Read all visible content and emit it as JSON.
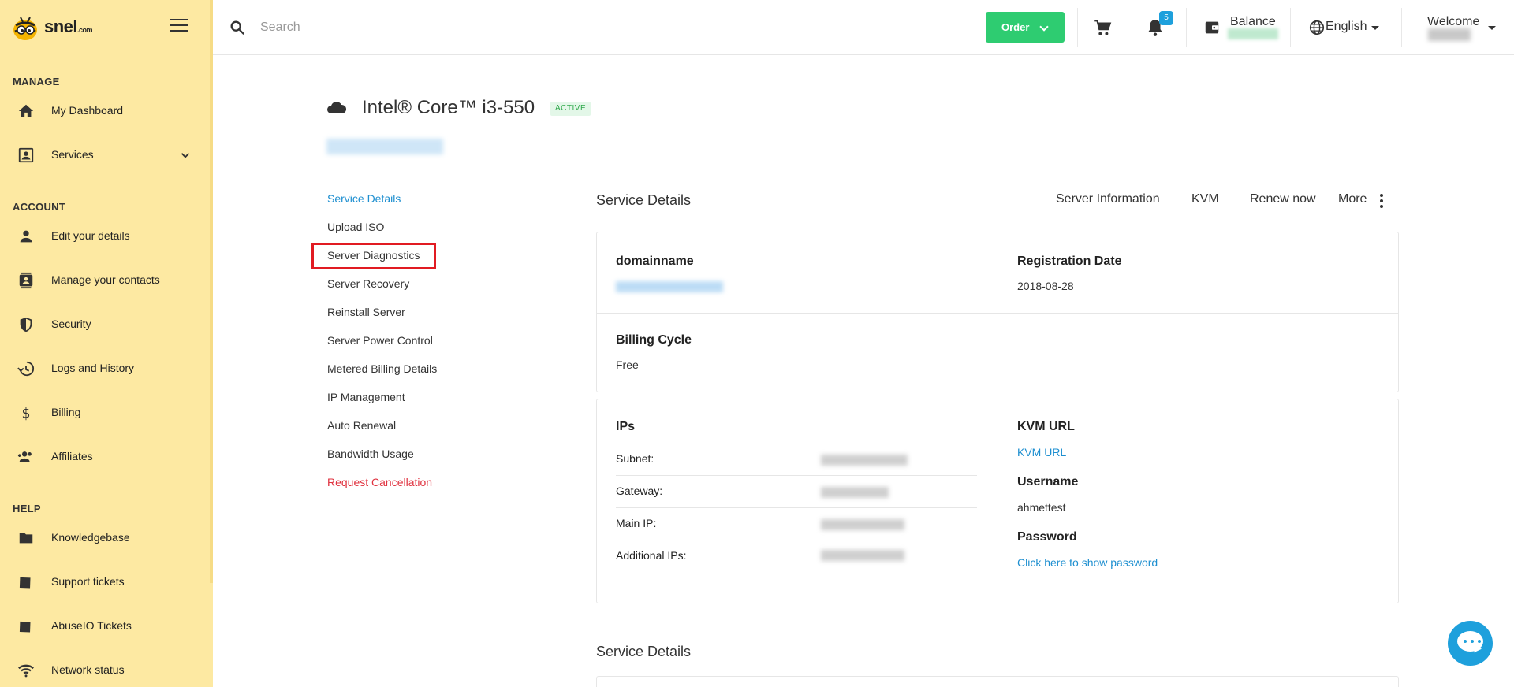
{
  "brand": {
    "name": "snel",
    "suffix": ".com"
  },
  "search": {
    "placeholder": "Search"
  },
  "header": {
    "order_label": "Order",
    "notifications_count": "5",
    "balance_label": "Balance",
    "language": "English",
    "welcome_label": "Welcome"
  },
  "sidebar": {
    "sections": [
      {
        "label": "MANAGE"
      },
      {
        "label": "ACCOUNT"
      },
      {
        "label": "HELP"
      }
    ],
    "items": [
      {
        "label": "My Dashboard",
        "icon": "home-icon"
      },
      {
        "label": "Services",
        "icon": "id-card-icon"
      },
      {
        "label": "Edit your details",
        "icon": "person-icon"
      },
      {
        "label": "Manage your contacts",
        "icon": "contacts-icon"
      },
      {
        "label": "Security",
        "icon": "shield-icon"
      },
      {
        "label": "Logs and History",
        "icon": "history-icon"
      },
      {
        "label": "Billing",
        "icon": "dollar-icon"
      },
      {
        "label": "Affiliates",
        "icon": "group-add-icon"
      },
      {
        "label": "Knowledgebase",
        "icon": "folder-icon"
      },
      {
        "label": "Support tickets",
        "icon": "ticket-icon"
      },
      {
        "label": "AbuseIO Tickets",
        "icon": "ticket-icon"
      },
      {
        "label": "Network status",
        "icon": "wifi-icon"
      }
    ]
  },
  "service": {
    "title": "Intel® Core™ i3-550",
    "status": "ACTIVE"
  },
  "service_nav": [
    {
      "label": "Service Details"
    },
    {
      "label": "Upload ISO"
    },
    {
      "label": "Server Diagnostics"
    },
    {
      "label": "Server Recovery"
    },
    {
      "label": "Reinstall Server"
    },
    {
      "label": "Server Power Control"
    },
    {
      "label": "Metered Billing Details"
    },
    {
      "label": "IP Management"
    },
    {
      "label": "Auto Renewal"
    },
    {
      "label": "Bandwidth Usage"
    },
    {
      "label": "Request Cancellation"
    }
  ],
  "details": {
    "section_title": "Service Details",
    "tabs": [
      {
        "label": "Server Information"
      },
      {
        "label": "KVM"
      },
      {
        "label": "Renew now"
      },
      {
        "label": "More"
      }
    ],
    "domainname_label": "domainname",
    "registration_label": "Registration Date",
    "registration_value": "2018-08-28",
    "billing_label": "Billing Cycle",
    "billing_value": "Free"
  },
  "ips": {
    "title": "IPs",
    "rows": [
      {
        "label": "Subnet:"
      },
      {
        "label": "Gateway:"
      },
      {
        "label": "Main IP:"
      },
      {
        "label": "Additional IPs:"
      }
    ]
  },
  "kvm": {
    "title": "KVM URL",
    "link": "KVM URL",
    "username_label": "Username",
    "username_value": "ahmettest",
    "password_label": "Password",
    "password_link": "Click here to show password"
  },
  "details_bottom": {
    "section_title": "Service Details"
  },
  "colors": {
    "sidebar_bg": "#fde9a2",
    "accent_green": "#2ecc71",
    "link_blue": "#1e8fd0",
    "danger_red": "#e0323f",
    "highlight_red": "#e11b22"
  }
}
